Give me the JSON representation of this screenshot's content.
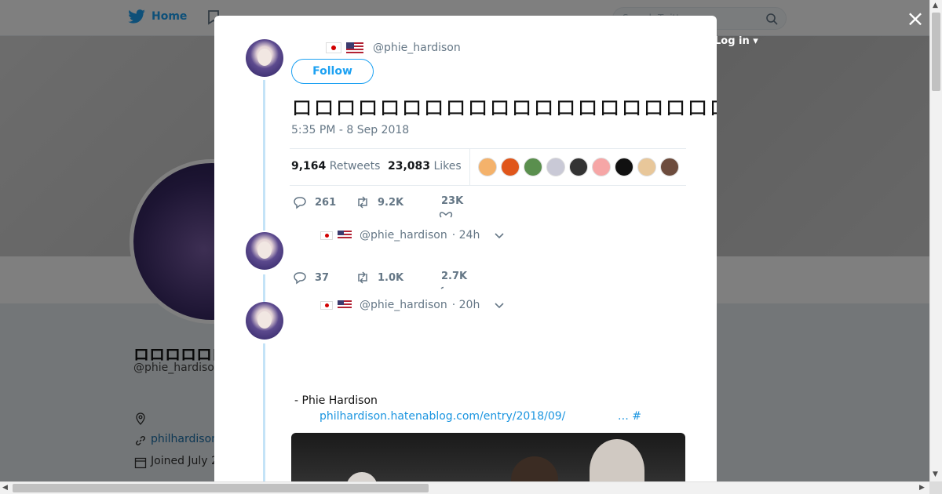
{
  "background": {
    "nav": {
      "home_label": "Home",
      "search_placeholder": "Search Twitter",
      "login_label": "Log in"
    },
    "profile": {
      "name": "ロロロロロロL",
      "handle": "@phie_hardison",
      "link": "philhardison",
      "joined": "Joined July 2"
    }
  },
  "modal": {
    "close_label": "×",
    "tweet": {
      "handle": "@phie_hardison",
      "follow_label": "Follow",
      "text": "ロロロロロロロロロロロロロロロロロロロロロロロロロロロロロロロロロロロロロロロロロロロロロロロロロ",
      "timestamp": "5:35 PM - 8 Sep 2018",
      "retweets_count": "9,164",
      "retweets_label": "Retweets",
      "likes_count": "23,083",
      "likes_label": "Likes",
      "likers": [
        "#f4b26b",
        "#e0561b",
        "#5a8f4e",
        "#c9c9d6",
        "#333333",
        "#f6a6a6",
        "#111111",
        "#e8c79a",
        "#6d4c3d"
      ],
      "replies": "261",
      "retweets_short": "9.2K",
      "likes_short": "23K"
    },
    "replies": [
      {
        "handle": "@phie_hardison",
        "time": "· 24h",
        "replies": "37",
        "retweets": "1.0K",
        "likes": "2.7K"
      },
      {
        "handle": "@phie_hardison",
        "time": "· 20h",
        "caption": "- Phie Hardison",
        "link": "philhardison.hatenablog.com/entry/2018/09/",
        "link_tail": "… #"
      }
    ]
  },
  "colors": {
    "accent": "#1da1f2",
    "thread_line": "#c4e3f7",
    "muted": "#657786"
  }
}
